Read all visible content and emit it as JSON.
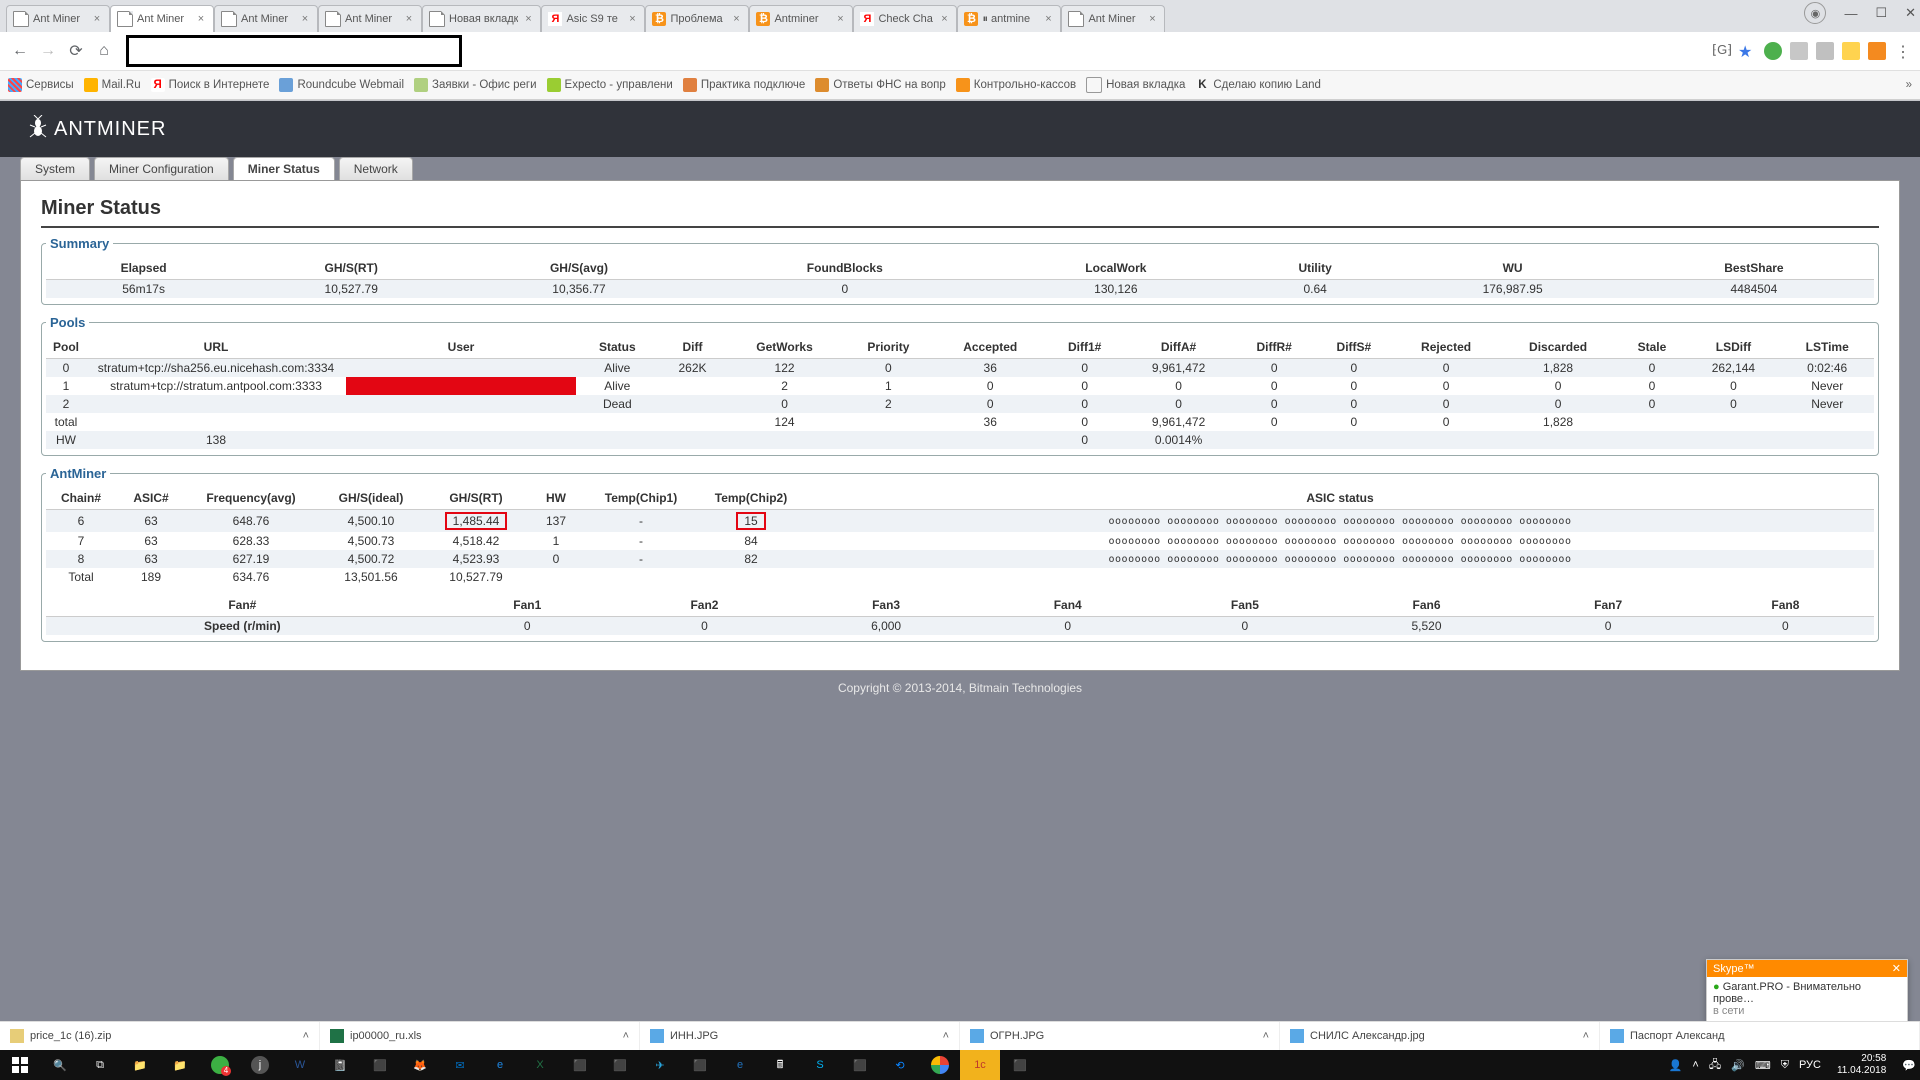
{
  "browser": {
    "tabs": [
      {
        "title": "Ant Miner",
        "fav": "file"
      },
      {
        "title": "Ant Miner",
        "fav": "file",
        "active": true
      },
      {
        "title": "Ant Miner",
        "fav": "file"
      },
      {
        "title": "Ant Miner",
        "fav": "file"
      },
      {
        "title": "Новая вкладк",
        "fav": "file"
      },
      {
        "title": "Asic S9 те",
        "fav": "y"
      },
      {
        "title": "Проблема",
        "fav": "b"
      },
      {
        "title": "Antminer",
        "fav": "b"
      },
      {
        "title": "Check Cha",
        "fav": "y"
      },
      {
        "title": "⏸ antmine",
        "fav": "b"
      },
      {
        "title": "Ant Miner",
        "fav": "file"
      }
    ],
    "win_controls": {
      "min": "—",
      "max": "☐",
      "close": "✕"
    },
    "bookmarks": [
      {
        "label": "Сервисы",
        "icon": "apps"
      },
      {
        "label": "Mail.Ru",
        "icon": "mail"
      },
      {
        "label": "Поиск в Интернете",
        "icon": "y"
      },
      {
        "label": "Roundcube Webmail",
        "icon": "rc"
      },
      {
        "label": "Заявки - Офис реги",
        "icon": "doc"
      },
      {
        "label": "Expecto - управлени",
        "icon": "ex"
      },
      {
        "label": "Практика подключе",
        "icon": "doc"
      },
      {
        "label": "Ответы ФНС на вопр",
        "icon": "fns"
      },
      {
        "label": "Контрольно-кассов",
        "icon": "kk"
      },
      {
        "label": "Новая вкладка",
        "icon": "file"
      },
      {
        "label": "Сделаю копию Land",
        "icon": "k"
      }
    ],
    "more": "»"
  },
  "page": {
    "logo": "ANTMINER",
    "tabs": [
      "System",
      "Miner Configuration",
      "Miner Status",
      "Network"
    ],
    "active_tab": "Miner Status",
    "title": "Miner Status",
    "summary": {
      "legend": "Summary",
      "headers": [
        "Elapsed",
        "GH/S(RT)",
        "GH/S(avg)",
        "FoundBlocks",
        "LocalWork",
        "Utility",
        "WU",
        "BestShare"
      ],
      "values": [
        "56m17s",
        "10,527.79",
        "10,356.77",
        "0",
        "130,126",
        "0.64",
        "176,987.95",
        "4484504"
      ]
    },
    "pools": {
      "legend": "Pools",
      "headers": [
        "Pool",
        "URL",
        "User",
        "Status",
        "Diff",
        "GetWorks",
        "Priority",
        "Accepted",
        "Diff1#",
        "DiffA#",
        "DiffR#",
        "DiffS#",
        "Rejected",
        "Discarded",
        "Stale",
        "LSDiff",
        "LSTime"
      ],
      "rows": [
        [
          "0",
          "stratum+tcp://sha256.eu.nicehash.com:3334",
          "",
          "Alive",
          "262K",
          "122",
          "0",
          "36",
          "0",
          "9,961,472",
          "0",
          "0",
          "0",
          "1,828",
          "0",
          "262,144",
          "0:02:46"
        ],
        [
          "1",
          "stratum+tcp://stratum.antpool.com:3333",
          "",
          "Alive",
          "",
          "2",
          "1",
          "0",
          "0",
          "0",
          "0",
          "0",
          "0",
          "0",
          "0",
          "0",
          "Never"
        ],
        [
          "2",
          "",
          "",
          "Dead",
          "",
          "0",
          "2",
          "0",
          "0",
          "0",
          "0",
          "0",
          "0",
          "0",
          "0",
          "0",
          "Never"
        ],
        [
          "total",
          "",
          "",
          "",
          "",
          "124",
          "",
          "36",
          "0",
          "9,961,472",
          "0",
          "0",
          "0",
          "1,828",
          "",
          "",
          ""
        ],
        [
          "HW",
          "138",
          "",
          "",
          "",
          "",
          "",
          "",
          "0",
          "0.0014%",
          "",
          "",
          "",
          "",
          "",
          "",
          ""
        ]
      ]
    },
    "antminer": {
      "legend": "AntMiner",
      "headers": [
        "Chain#",
        "ASIC#",
        "Frequency(avg)",
        "GH/S(ideal)",
        "GH/S(RT)",
        "HW",
        "Temp(Chip1)",
        "Temp(Chip2)",
        "ASIC status"
      ],
      "rows": [
        [
          "6",
          "63",
          "648.76",
          "4,500.10",
          "1,485.44",
          "137",
          "-",
          "15",
          "oooooooo oooooooo oooooooo oooooooo oooooooo oooooooo oooooooo oooooooo"
        ],
        [
          "7",
          "63",
          "628.33",
          "4,500.73",
          "4,518.42",
          "1",
          "-",
          "84",
          "oooooooo oooooooo oooooooo oooooooo oooooooo oooooooo oooooooo oooooooo"
        ],
        [
          "8",
          "63",
          "627.19",
          "4,500.72",
          "4,523.93",
          "0",
          "-",
          "82",
          "oooooooo oooooooo oooooooo oooooooo oooooooo oooooooo oooooooo oooooooo"
        ],
        [
          "Total",
          "189",
          "634.76",
          "13,501.56",
          "10,527.79",
          "",
          "",
          "",
          ""
        ]
      ],
      "highlight": {
        "ghs_rt_row0": true,
        "temp2_row0": true
      }
    },
    "fans": {
      "row_head": [
        "Fan#",
        "Fan1",
        "Fan2",
        "Fan3",
        "Fan4",
        "Fan5",
        "Fan6",
        "Fan7",
        "Fan8"
      ],
      "row_vals": [
        "Speed (r/min)",
        "0",
        "0",
        "6,000",
        "0",
        "0",
        "5,520",
        "0",
        "0"
      ]
    },
    "copyright": "Copyright © 2013-2014, Bitmain Technologies"
  },
  "running_apps": [
    {
      "label": "price_1c (16).zip"
    },
    {
      "label": "ip00000_ru.xls"
    },
    {
      "label": "ИНН.JPG"
    },
    {
      "label": "ОГРН.JPG"
    },
    {
      "label": "СНИЛС Александр.jpg"
    },
    {
      "label": "Паспорт Александ"
    }
  ],
  "skype": {
    "brand": "Skype™",
    "close": "✕",
    "title": "Garant.PRO - Внимательно прове…",
    "status": "в сети"
  },
  "taskbar": {
    "lang": "РУС",
    "time": "20:58",
    "date": "11.04.2018"
  }
}
